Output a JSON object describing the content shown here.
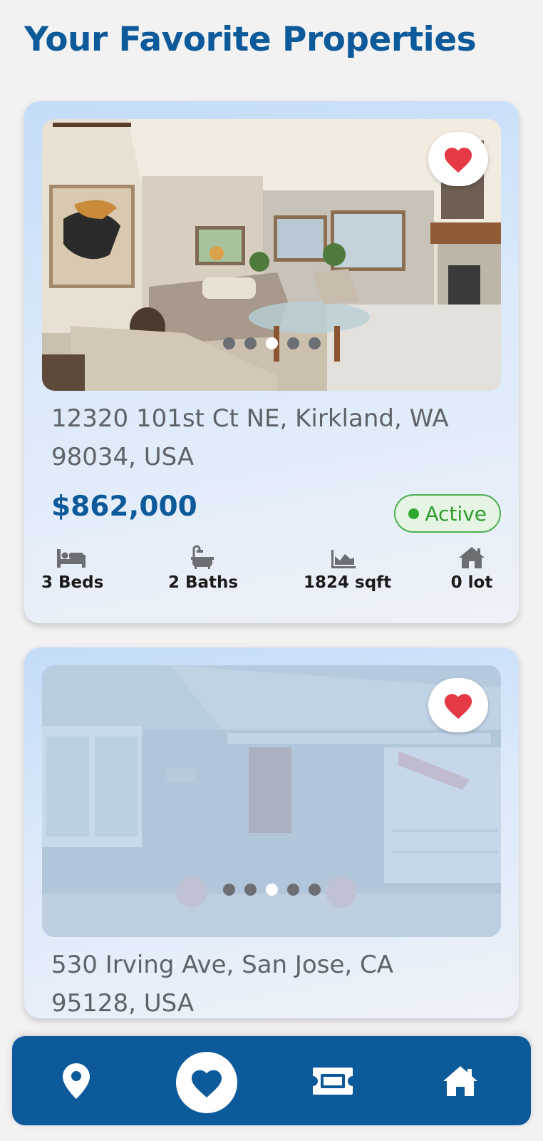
{
  "page": {
    "title": "Your Favorite Properties"
  },
  "listings": [
    {
      "address": "12320 101st Ct NE, Kirkland, WA 98034, USA",
      "price": "$862,000",
      "status": "Active",
      "favorited": true,
      "photo_dots": {
        "count": 5,
        "active_index": 2
      },
      "stats": {
        "beds": "3 Beds",
        "baths": "2 Baths",
        "sqft": "1824 sqft",
        "lot": "0 lot"
      },
      "icons": {
        "beds": "bed-icon",
        "baths": "bathtub-icon",
        "sqft": "area-chart-icon",
        "lot": "house-icon"
      }
    },
    {
      "address": "530 Irving Ave, San Jose, CA 95128, USA",
      "favorited": true,
      "photo_dots": {
        "count": 5,
        "active_index": 2
      }
    }
  ],
  "bottom_nav": {
    "items": [
      {
        "icon": "map-pin-icon"
      },
      {
        "icon": "heart-icon",
        "active": true
      },
      {
        "icon": "ticket-icon"
      },
      {
        "icon": "home-icon"
      }
    ]
  },
  "colors": {
    "brand": "#0d5a9b",
    "favorite": "#e53945",
    "active_status": "#2e9b2e"
  }
}
